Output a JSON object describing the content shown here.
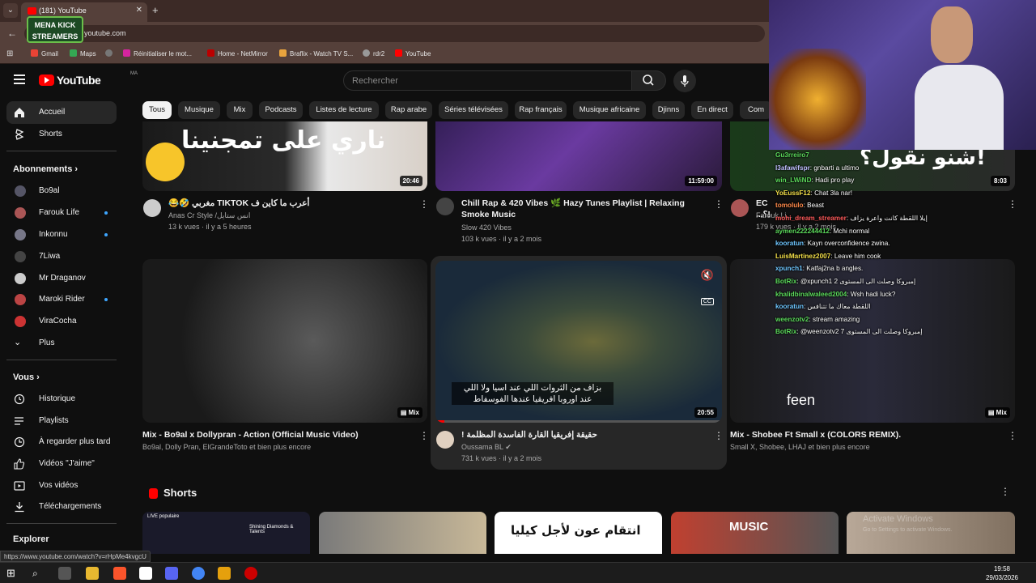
{
  "browser": {
    "tab_title": "(181) YouTube",
    "url": "youtube.com",
    "bookmarks": [
      "Gmail",
      "Maps",
      "Réinitialiser le mot...",
      "Home - NetMirror",
      "Braflix - Watch TV S...",
      "rdr2",
      "YouTube"
    ],
    "overlay_logo_line1": "MENA KICK",
    "overlay_logo_line2": "STREAMERS"
  },
  "youtube": {
    "logo_text": "YouTube",
    "country_code": "MA",
    "search_placeholder": "Rechercher"
  },
  "sidebar": {
    "home": "Accueil",
    "shorts": "Shorts",
    "subscriptions_title": "Abonnements",
    "subscriptions": [
      {
        "name": "Bo9al",
        "live": false
      },
      {
        "name": "Farouk Life",
        "live": true
      },
      {
        "name": "Inkonnu",
        "live": true
      },
      {
        "name": "7Liwa",
        "live": false
      },
      {
        "name": "Mr Draganov",
        "live": false
      },
      {
        "name": "Maroki Rider",
        "live": true
      },
      {
        "name": "ViraCocha",
        "live": false
      }
    ],
    "more": "Plus",
    "you_title": "Vous",
    "you_items": [
      "Historique",
      "Playlists",
      "À regarder plus tard",
      "Vidéos \"J'aime\"",
      "Vos vidéos",
      "Téléchargements"
    ],
    "explore_title": "Explorer"
  },
  "chips": [
    "Tous",
    "Musique",
    "Mix",
    "Podcasts",
    "Listes de lecture",
    "Rap arabe",
    "Séries télévisées",
    "Rap français",
    "Musique africaine",
    "Djinns",
    "En direct",
    "Com"
  ],
  "videos_row1": [
    {
      "thumb_text": "ناري على تمجنينا",
      "duration": "20:46",
      "title": "أعرب ما كاين ف TIKTOK مغربي 🤣😂",
      "channel": "Anas Cr Style /انس ستايل",
      "meta": "13 k vues · il y a 5 heures"
    },
    {
      "duration": "11:59:00",
      "title": "Chill Rap & 420 Vibes 🌿 Hazy Tunes Playlist | Relaxing Smoke Music",
      "channel": "Slow 420 Vibes",
      "meta": "103 k vues · il y a 2 mois"
    },
    {
      "thumb_text": "شنو نقول؟!",
      "duration": "8:03",
      "title": "EC ...؟!",
      "channel": "Farouk Li...",
      "meta": "179 k vues · il y a 2 mois"
    }
  ],
  "videos_row2": [
    {
      "badge": "Mix",
      "title": "Mix - Bo9al x Dollypran - Action (Official Music Video)",
      "meta": "Bo9al, Dolly Pran, ElGrandeToto et bien plus encore"
    },
    {
      "subtitle_line1": "بزاف من الثروات اللي عند اسيا ولا اللي",
      "subtitle_line2": "عند اوروبا افريقيا عندها الفوسفاط",
      "cc": "CC",
      "duration": "20:55",
      "title": "حقيقة إفريقيا القارة الفاسدة المظلمة !",
      "channel": "Oussama BL",
      "meta": "731 k vues · il y a 2 mois"
    },
    {
      "thumb_text": "feen",
      "badge": "Mix",
      "title": "Mix - Shobee Ft Small x (COLORS REMIX).",
      "meta": "Small X, Shobee, LHAJ et bien plus encore"
    }
  ],
  "shorts_section": {
    "title": "Shorts",
    "short1_live": "LIVE populaire",
    "short1_text": "Shining Diamonds & Talents",
    "short3_text": "انتقام عون لأجل كيليا",
    "short4_text": "MUSIC"
  },
  "status_url": "https://www.youtube.com/watch?v=rHpMe4kvgcU",
  "chat": [
    {
      "user": "Gu3rreiro7",
      "msg": "",
      "color": "#5bd95b"
    },
    {
      "user": "l3afawifspr",
      "msg": "gnbarti a ultimo",
      "color": "#c0c0ff"
    },
    {
      "user": "win_LWiND",
      "msg": "Hadi pro play",
      "color": "#5bd95b"
    },
    {
      "user": "YoEussF12",
      "msg": "Chat 3la nar!",
      "color": "#f5e14a"
    },
    {
      "user": "tomolulo",
      "msg": "Beast",
      "color": "#ff8a4a"
    },
    {
      "user": "mohi_dream_streamer",
      "msg": "إيلا اللقطة كانت واعرة يزاف",
      "color": "#ff5a5a"
    },
    {
      "user": "aymen222244412",
      "msg": "Mchi normal",
      "color": "#5bd95b"
    },
    {
      "user": "kooratun",
      "msg": "Kayn overconfidence zwina.",
      "color": "#6ec6ff"
    },
    {
      "user": "LuisMartinez2007",
      "msg": "Leave him cook",
      "color": "#f5e14a"
    },
    {
      "user": "xpunch1",
      "msg": "Katfaj2na b angles.",
      "color": "#6ec6ff"
    },
    {
      "user": "BotRix",
      "msg": "@xpunch1 2 إمبروكا وصلت الى المستوى",
      "color": "#5bd95b"
    },
    {
      "user": "khalidbinalwaleed2004",
      "msg": "Wsh hadi luck?",
      "color": "#5bd95b"
    },
    {
      "user": "kooratun",
      "msg": "اللقطة معاك ما تتنافس",
      "color": "#6ec6ff"
    },
    {
      "user": "weenzotv2",
      "msg": "stream amazing",
      "color": "#5bd95b"
    },
    {
      "user": "BotRix",
      "msg": "@weenzotv2 7 إمبروكا وصلت الى المستوى",
      "color": "#5bd95b"
    }
  ],
  "watermark": {
    "line1": "Activate Windows",
    "line2": "Go to Settings to activate Windows."
  },
  "taskbar": {
    "time": "19:58",
    "date": "29/03/2026"
  }
}
